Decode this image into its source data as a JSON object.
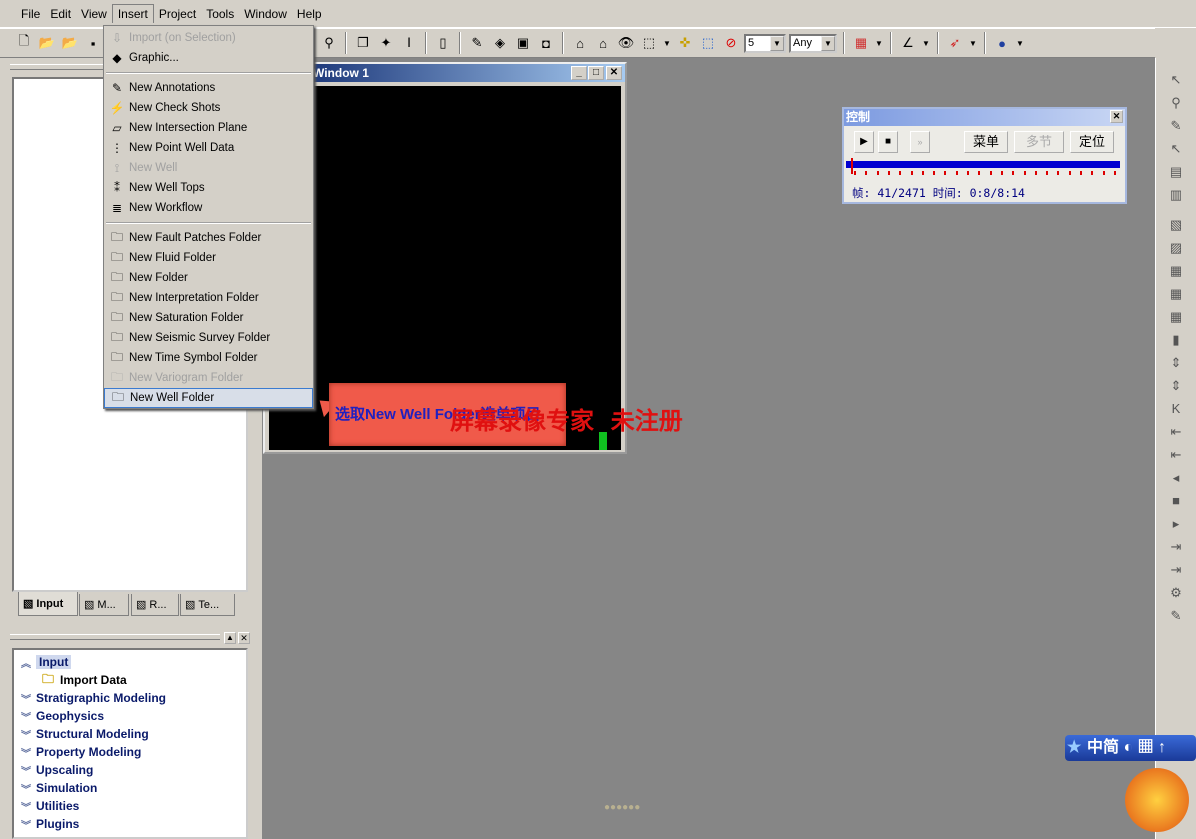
{
  "menubar": [
    "File",
    "Edit",
    "View",
    "Insert",
    "Project",
    "Tools",
    "Window",
    "Help"
  ],
  "toolbar": {
    "combo1": "5",
    "combo2": "Any"
  },
  "insert_menu": {
    "items": [
      {
        "label": "Import (on Selection)",
        "icon": "import-icon",
        "disabled": true
      },
      {
        "label": "Graphic...",
        "icon": "graphic-icon"
      },
      {
        "sep": true
      },
      {
        "label": "New Annotations",
        "icon": "annotations-icon"
      },
      {
        "label": "New Check Shots",
        "icon": "check-shots-icon"
      },
      {
        "label": "New Intersection Plane",
        "icon": "intersection-plane-icon"
      },
      {
        "label": "New Point Well Data",
        "icon": "point-well-data-icon"
      },
      {
        "label": "New Well",
        "icon": "well-icon",
        "disabled": true
      },
      {
        "label": "New Well Tops",
        "icon": "well-tops-icon"
      },
      {
        "label": "New Workflow",
        "icon": "workflow-icon"
      },
      {
        "sep": true
      },
      {
        "label": "New Fault Patches Folder",
        "icon": "folder-icon"
      },
      {
        "label": "New Fluid Folder",
        "icon": "folder-icon"
      },
      {
        "label": "New Folder",
        "icon": "folder-icon"
      },
      {
        "label": "New Interpretation Folder",
        "icon": "folder-icon"
      },
      {
        "label": "New Saturation Folder",
        "icon": "folder-icon"
      },
      {
        "label": "New Seismic Survey Folder",
        "icon": "folder-icon"
      },
      {
        "label": "New Time Symbol Folder",
        "icon": "folder-icon"
      },
      {
        "label": "New Variogram Folder",
        "icon": "folder-icon",
        "disabled": true
      },
      {
        "label": "New Well Folder",
        "icon": "folder-icon",
        "selected": true
      }
    ]
  },
  "window1": {
    "title": "Window 1"
  },
  "callout": {
    "text": "选取New Well Folder选单项目",
    "bg": "#f05a4a"
  },
  "watermark": "屏幕录像专家  未注册",
  "control": {
    "title": "控制",
    "menu": "菜单",
    "multi": "多节",
    "locate": "定位",
    "status": "帧: 41/2471 时间: 0:8/8:14",
    "progress": 0.0166
  },
  "tabs": [
    "Input",
    "M...",
    "R...",
    "Te..."
  ],
  "workflow": {
    "items": [
      "Input",
      "Import Data",
      "Stratigraphic Modeling",
      "Geophysics",
      "Structural Modeling",
      "Property Modeling",
      "Upscaling",
      "Simulation",
      "Utilities",
      "Plugins"
    ]
  },
  "ime": {
    "label": "中简"
  }
}
